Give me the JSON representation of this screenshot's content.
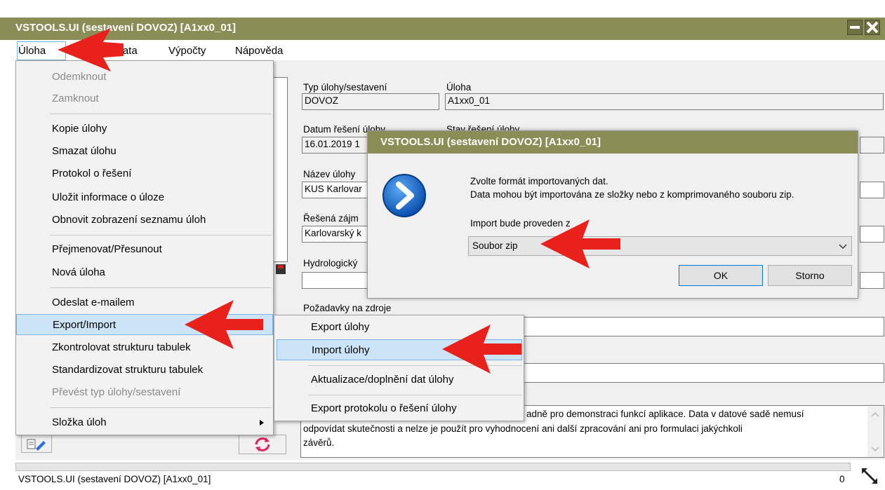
{
  "window": {
    "title": "VSTOOLS.UI (sestavení DOVOZ) [A1xx0_01]"
  },
  "menubar": {
    "items": [
      "Úloha",
      "Data",
      "Výpočty",
      "Nápověda"
    ]
  },
  "form": {
    "typ_label": "Typ úlohy/sestavení",
    "typ_value": "DOVOZ",
    "uloha_label": "Úloha",
    "uloha_value": "A1xx0_01",
    "datum_label": "Datum řešení úlohy",
    "datum_value": "16.01.2019 1",
    "stav_label": "Stav řešení úlohy",
    "nazev_label": "Název úlohy",
    "nazev_value": "KUS Karlovar",
    "resena_label": "Řešená zájm",
    "resena_value": "Karlovarský k",
    "hydro_label": "Hydrologický",
    "pozadavky_label": "Požadavky na zdroje",
    "desc_line1": "adně pro demonstraci funkcí aplikace. Data v datové sadě nemusí",
    "desc_line2": "odpovídat skutečnosti a nelze je použít pro vyhodnocení ani další zpracování ani pro formulaci jakýchkoli",
    "desc_line3": "závěrů."
  },
  "uloha_menu": {
    "items": [
      "Odemknout",
      "Zamknout",
      "Kopie úlohy",
      "Smazat úlohu",
      "Protokol o řešení",
      "Uložit informace o úloze",
      "Obnovit zobrazení seznamu úloh",
      "Přejmenovat/Přesunout",
      "Nová úloha",
      "Odeslat e-mailem",
      "Export/Import",
      "Zkontrolovat strukturu tabulek",
      "Standardizovat strukturu tabulek",
      "Převést typ úlohy/sestavení",
      "Složka úloh"
    ]
  },
  "submenu": {
    "items": [
      "Export úlohy",
      "Import úlohy",
      "Aktualizace/doplnění dat úlohy",
      "Export protokolu o řešení úlohy"
    ]
  },
  "dialog": {
    "title": "VSTOOLS.UI (sestavení DOVOZ) [A1xx0_01]",
    "line1": "Zvolte formát importovaných dat.",
    "line2": "Data mohou být importována ze složky nebo z komprimovaného souboru zip.",
    "import_label": "Import bude proveden z",
    "select_value": "Soubor zip",
    "ok": "OK",
    "cancel": "Storno"
  },
  "status": {
    "text": "VSTOOLS.UI (sestavení DOVOZ) [A1xx0_01]",
    "count": "0"
  },
  "colors": {
    "titlebar": "#8b8d57",
    "highlight": "#cce4f7",
    "arrow": "#e8211c",
    "info_icon": "#1565c0"
  }
}
